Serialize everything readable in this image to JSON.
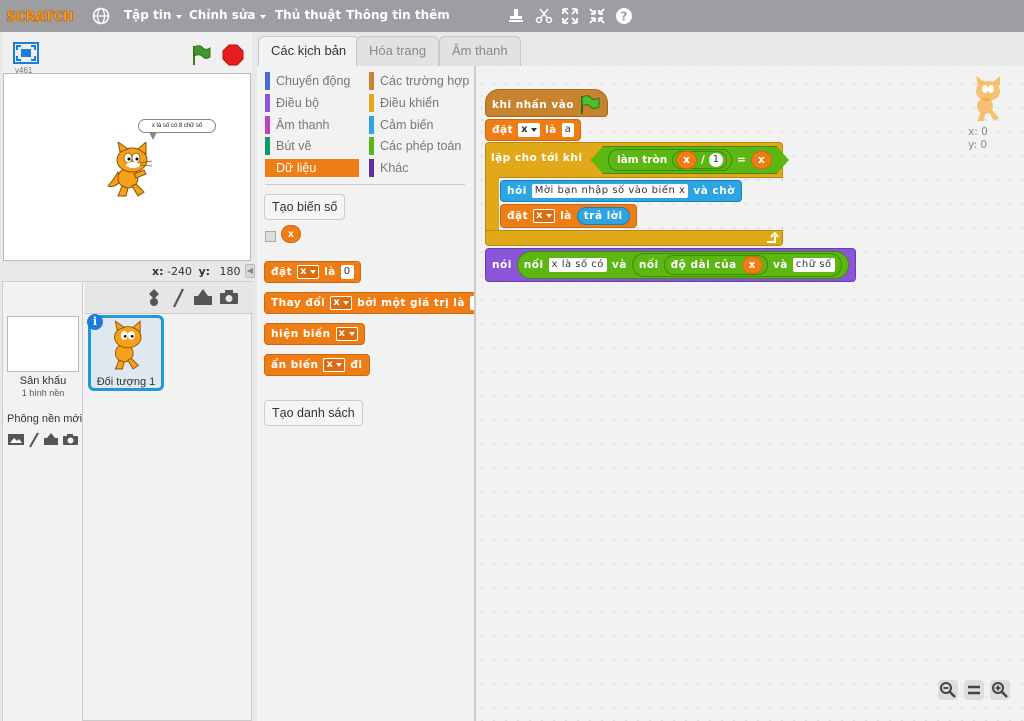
{
  "menubar": {
    "logo": "SCRATCH",
    "items": [
      "Tập tin",
      "Chỉnh sửa",
      "Thủ thuật",
      "Thông tin thêm"
    ]
  },
  "stage": {
    "version": "v461",
    "speech": "x là số có 8 chữ số",
    "coord_x_label": "x:",
    "coord_x": "-240",
    "coord_y_label": "y:",
    "coord_y": "180"
  },
  "sprites": {
    "stage_label": "Sân khấu",
    "stage_sub": "1 hình nền",
    "backdrop_label": "Phông nền mới",
    "sprite_name": "Đối tượng 1",
    "info": "i"
  },
  "tabs": [
    "Các kịch bản",
    "Hóa trang",
    "Âm thanh"
  ],
  "palette": {
    "categories_left": [
      {
        "label": "Chuyển động",
        "color": "#4a6cd4"
      },
      {
        "label": "Điều bộ",
        "color": "#8a55d7"
      },
      {
        "label": "Âm thanh",
        "color": "#bb42c3"
      },
      {
        "label": "Bút vẽ",
        "color": "#0e9a6c"
      },
      {
        "label": "Dữ liệu",
        "color": "#ee7d16"
      }
    ],
    "categories_right": [
      {
        "label": "Các trường hợp",
        "color": "#c88330"
      },
      {
        "label": "Điều khiển",
        "color": "#e1a91a"
      },
      {
        "label": "Cảm biến",
        "color": "#2ca5e2"
      },
      {
        "label": "Các phép toán",
        "color": "#5cb712"
      },
      {
        "label": "Khác",
        "color": "#632d99"
      }
    ],
    "make_variable": "Tạo biến số",
    "var_name": "x",
    "block_set": {
      "a": "đặt",
      "var": "x",
      "b": "là",
      "val": "0"
    },
    "block_change": {
      "a": "Thay đổi",
      "var": "x",
      "b": "bởi một giá trị là"
    },
    "block_show": {
      "a": "hiện biến",
      "var": "x"
    },
    "block_hide": {
      "a": "ẩn biến",
      "var": "x",
      "b": "đi"
    },
    "make_list": "Tạo danh sách"
  },
  "script": {
    "hat": "khi nhấn vào",
    "set1": {
      "a": "đặt",
      "var": "x",
      "b": "là",
      "val": "a"
    },
    "repeat": {
      "a": "lặp cho tới khi",
      "round": "làm tròn",
      "var1": "x",
      "op": "/",
      "num": "1",
      "eq": "=",
      "var2": "x"
    },
    "ask": {
      "a": "hỏi",
      "text": "Mời bạn nhập số vào biến x",
      "b": "và chờ"
    },
    "set2": {
      "a": "đặt",
      "var": "x",
      "b": "là",
      "answer": "trả lời"
    },
    "say": {
      "a": "nói",
      "join1": "nối",
      "text1": "x là số có",
      "and1": "và",
      "join2": "nối",
      "len": "độ dài của",
      "var": "x",
      "and2": "và",
      "text2": "chữ số"
    }
  },
  "sprite_info": {
    "x_label": "x:",
    "x": "0",
    "y_label": "y:",
    "y": "0"
  },
  "colors": {
    "data": "#ee7d16",
    "control": "#e1a91a",
    "operators": "#5cb712",
    "sensing": "#2ca5e2",
    "looks": "#8a55d7",
    "events": "#c88330",
    "menubar": "#9c9ea2"
  }
}
